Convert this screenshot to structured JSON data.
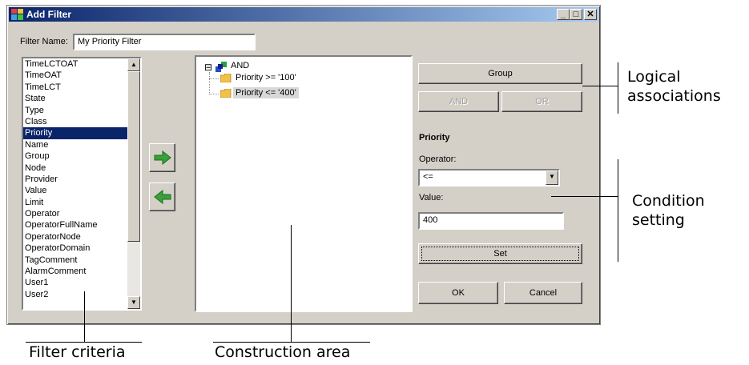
{
  "window": {
    "title": "Add Filter",
    "controls": [
      "_",
      "□",
      "✕"
    ]
  },
  "filter_name": {
    "label": "Filter Name:",
    "value": "My Priority Filter"
  },
  "criteria_list": {
    "items": [
      "TimeLCTOAT",
      "TimeOAT",
      "TimeLCT",
      "State",
      "Type",
      "Class",
      "Priority",
      "Name",
      "Group",
      "Node",
      "Provider",
      "Value",
      "Limit",
      "Operator",
      "OperatorFullName",
      "OperatorNode",
      "OperatorDomain",
      "TagComment",
      "AlarmComment",
      "User1",
      "User2"
    ],
    "selected": "Priority"
  },
  "move_buttons": {
    "add_icon": "arrow-right-icon",
    "remove_icon": "arrow-left-icon",
    "color": "#3aa03a"
  },
  "tree": {
    "root": "AND",
    "children": [
      "Priority >= '100'",
      "Priority <= '400'"
    ],
    "selected_child": "Priority <= '400'",
    "expander": "⊟"
  },
  "logic_buttons": {
    "group": "Group",
    "and": "AND",
    "or": "OR"
  },
  "condition": {
    "heading": "Priority",
    "operator_label": "Operator:",
    "operator_value": "<=",
    "value_label": "Value:",
    "value": "400",
    "set": "Set"
  },
  "dialog_buttons": {
    "ok": "OK",
    "cancel": "Cancel"
  },
  "annotations": {
    "logical": "Logical associations",
    "condition": "Condition setting",
    "filter_criteria": "Filter criteria",
    "construction": "Construction area"
  }
}
